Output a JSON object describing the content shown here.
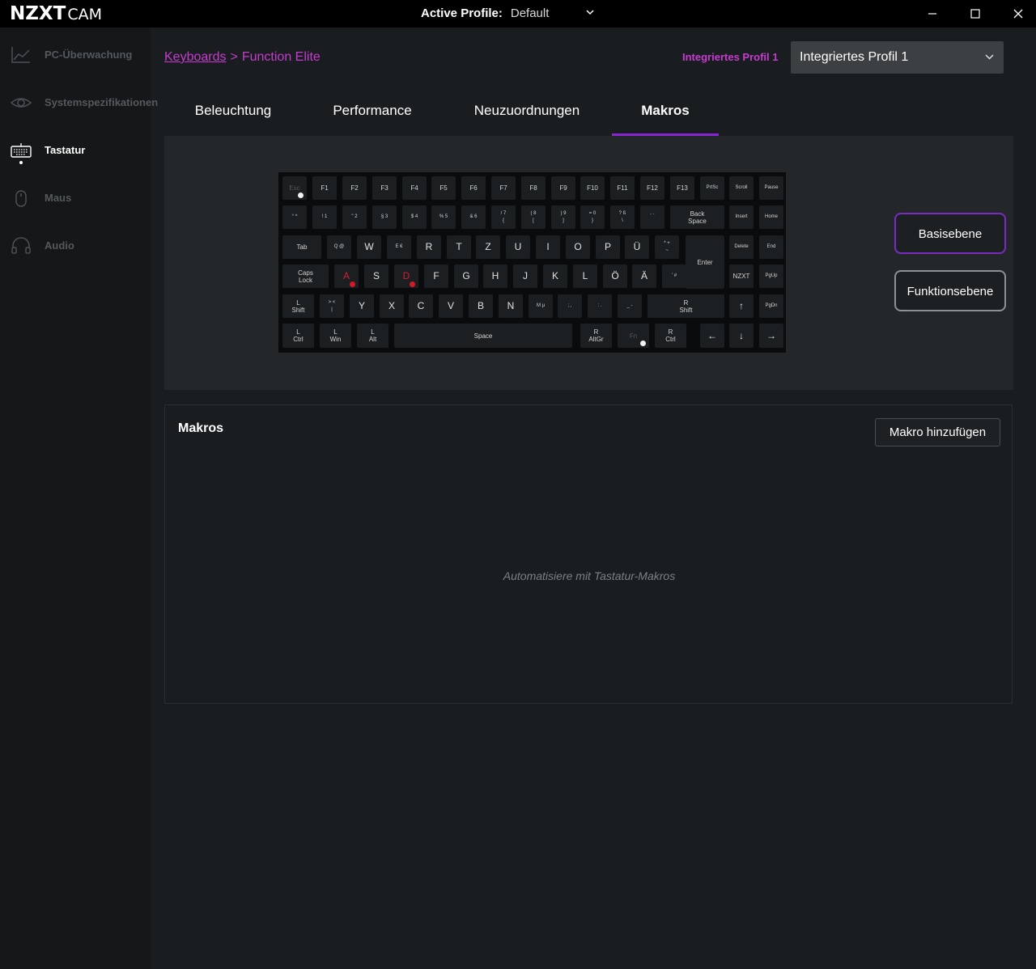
{
  "app": {
    "logo_main": "NZXT",
    "logo_sub": "CAM",
    "active_profile_label": "Active Profile:",
    "active_profile_value": "Default"
  },
  "sidebar": {
    "items": [
      {
        "label": "PC-Überwachung",
        "icon": "chart-line-icon"
      },
      {
        "label": "Systemspezifikationen",
        "icon": "eye-icon"
      },
      {
        "label": "Tastatur",
        "icon": "keyboard-icon"
      },
      {
        "label": "Maus",
        "icon": "mouse-icon"
      },
      {
        "label": "Audio",
        "icon": "headset-icon"
      }
    ]
  },
  "header": {
    "breadcrumb_root": "Keyboards",
    "breadcrumb_sep": ">",
    "breadcrumb_current": "Function Elite",
    "profile_label": "Integriertes Profil 1",
    "profile_value": "Integriertes Profil 1"
  },
  "tabs": [
    {
      "label": "Beleuchtung"
    },
    {
      "label": "Performance"
    },
    {
      "label": "Neuzuordnungen"
    },
    {
      "label": "Makros"
    }
  ],
  "keys": {
    "esc": "Esc",
    "f1": "F1",
    "f2": "F2",
    "f3": "F3",
    "f4": "F4",
    "f5": "F5",
    "f6": "F6",
    "f7": "F7",
    "f8": "F8",
    "f9": "F9",
    "f10": "F10",
    "f11": "F11",
    "f12": "F12",
    "f13": "F13",
    "prtsc": "PrtSc",
    "scroll": "Scroll",
    "pause": "Pause",
    "caret": "°  ^",
    "n1": "!  1",
    "n2": "\"  2",
    "n3": "§  3",
    "n4": "$  4",
    "n5": "%  5",
    "n6": "&  6",
    "n7": "/  7\n{",
    "n8": "(  8\n[",
    "n9": ")  9\n]",
    "n0": "=  0\n}",
    "sz": "?  ß\n\\",
    "acute": "`  ´",
    "backspace": "Back\nSpace",
    "insert": "Insert",
    "home": "Home",
    "tab": "Tab",
    "q": "Q  @",
    "w": "W",
    "e": "E  €",
    "r": "R",
    "t": "T",
    "z": "Z",
    "u": "U",
    "i": "I",
    "o": "O",
    "p": "P",
    "ue": "Ü",
    "plus": "*  +\n~",
    "enter": "Enter",
    "delete": "Delete",
    "end": "End",
    "caps": "Caps\nLock",
    "a": "A",
    "s": "S",
    "d": "D",
    "f": "F",
    "g": "G",
    "h": "H",
    "j": "J",
    "k": "K",
    "l": "L",
    "oe": "Ö",
    "ae": "Ä",
    "hash": "'  #",
    "nzxt": "NZXT",
    "pgup": "PgUp",
    "lshift": "L\nShift",
    "lt": ">  <\n|",
    "y": "Y",
    "x": "X",
    "c": "C",
    "v": "V",
    "b": "B",
    "n": "N",
    "m": "M  µ",
    "comma": ";  ,",
    "period": ":  .",
    "minus": "_  -",
    "rshift": "R\nShift",
    "up": "↑",
    "pgdn": "PgDn",
    "lctrl": "L\nCtrl",
    "lwin": "L\nWin",
    "lalt": "L\nAlt",
    "space": "Space",
    "ralt": "R\nAltGr",
    "fn": "Fn",
    "rctrl": "R\nCtrl",
    "left": "←",
    "down": "↓",
    "right": "→"
  },
  "layers": {
    "base_label": "Basisebene",
    "fn_label": "Funktionsebene"
  },
  "macros": {
    "title": "Makros",
    "add_button": "Makro hinzufügen",
    "empty_text": "Automatisiere mit Tastatur-Makros"
  },
  "colors": {
    "accent": "#c63bd0",
    "tab_underline": "#8a24d4",
    "macro_dot": "#d21a2a"
  }
}
